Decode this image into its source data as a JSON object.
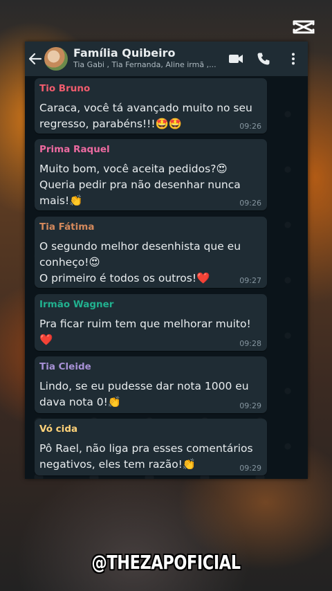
{
  "header": {
    "group_name": "Família Quibeiro",
    "members": "Tia Gabi , Tia Fernanda, Aline irmã ,..."
  },
  "messages": [
    {
      "sender": "Tio Bruno",
      "color": "#f15c6d",
      "text": "Caraca, você tá avançado muito no seu regresso, parabéns!!!🤩🤩",
      "time": "09:26"
    },
    {
      "sender": "Prima Raquel",
      "color": "#ec6aa0",
      "text": "Muito bom, você aceita pedidos?😍\nQueria pedir pra não desenhar nunca mais!👏",
      "time": "09:26"
    },
    {
      "sender": "Tia Fátima",
      "color": "#d4895c",
      "text": "O segundo melhor desenhista que eu conheço!😍\nO primeiro é todos os outros!❤️",
      "time": "09:27"
    },
    {
      "sender": "Irmão Wagner",
      "color": "#21b18f",
      "text": "Pra ficar ruim tem que melhorar muito!❤️",
      "time": "09:28"
    },
    {
      "sender": "Tia Cleide",
      "color": "#a791d6",
      "text": "Lindo, se eu pudesse dar nota 1000 eu dava nota 0!👏",
      "time": "09:29"
    },
    {
      "sender": "Vó cida",
      "color": "#ffd279",
      "text": "Pô Rael, não liga pra esses comentários negativos, eles tem razão!👏",
      "time": "09:29"
    }
  ],
  "watermark": "@THEZAPOFICIAL",
  "icons": {
    "back": "back-arrow-icon",
    "video": "video-call-icon",
    "call": "phone-call-icon",
    "menu": "more-vertical-icon",
    "editor_logo": "capcut-logo-icon"
  }
}
